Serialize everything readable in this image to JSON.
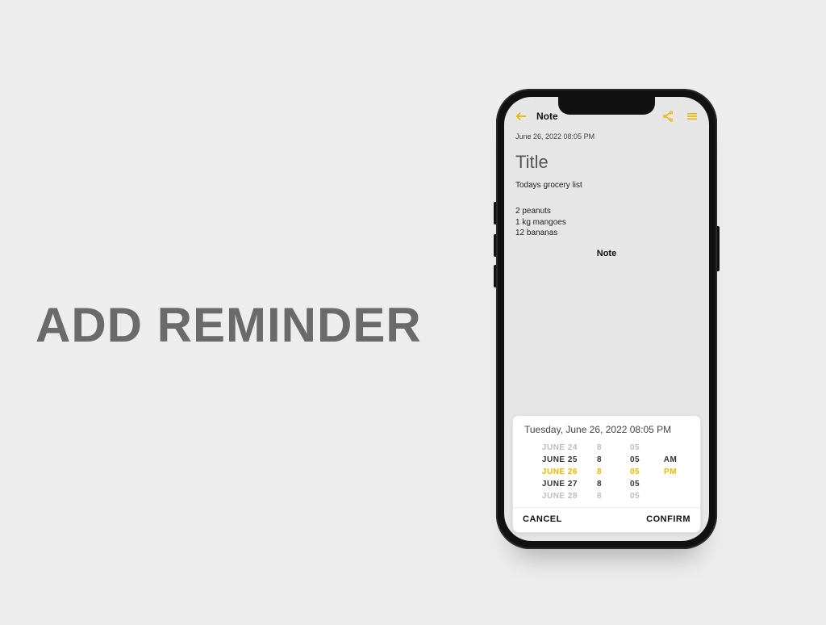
{
  "headline": "ADD REMINDER",
  "app": {
    "screen_title": "Note",
    "timestamp": "June 26, 2022 08:05 PM",
    "title_placeholder": "Title",
    "subtitle": "Todays grocery list",
    "items": [
      "2 peanuts",
      "1 kg mangoes",
      "12 bananas"
    ],
    "center_label": "Note"
  },
  "picker": {
    "header": "Tuesday, June 26, 2022 08:05 PM",
    "rows": [
      {
        "date": "JUNE 24",
        "hour": "8",
        "minute": "05",
        "ampm": "",
        "style": "fade"
      },
      {
        "date": "JUNE 25",
        "hour": "8",
        "minute": "05",
        "ampm": "AM",
        "style": "near"
      },
      {
        "date": "JUNE 26",
        "hour": "8",
        "minute": "05",
        "ampm": "PM",
        "style": "sel"
      },
      {
        "date": "JUNE 27",
        "hour": "8",
        "minute": "05",
        "ampm": "",
        "style": "near"
      },
      {
        "date": "JUNE 28",
        "hour": "8",
        "minute": "05",
        "ampm": "",
        "style": "fade"
      }
    ],
    "cancel": "CANCEL",
    "confirm": "CONFIRM"
  },
  "accent": "#e6b800"
}
